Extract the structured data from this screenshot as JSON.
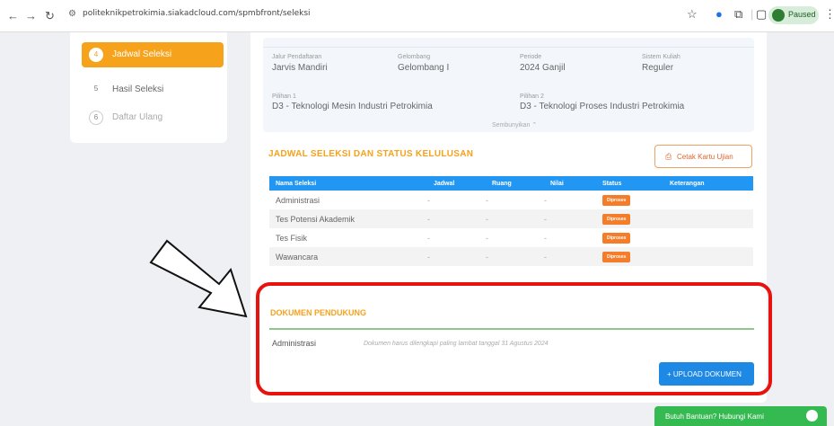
{
  "browser": {
    "url": "politeknikpetrokimia.siakadcloud.com/spmbfront/seleksi",
    "paused_label": "Paused",
    "colors": {
      "paused_bg": "#d7ecd9"
    }
  },
  "sidebar": {
    "items": [
      {
        "num": "4",
        "label": "Jadwal Seleksi",
        "active": true
      },
      {
        "num": "5",
        "label": "Hasil Seleksi",
        "active": false
      },
      {
        "num": "6",
        "label": "Daftar Ulang",
        "active": false
      }
    ]
  },
  "info": {
    "jalur_label": "Jalur Pendaftaran",
    "jalur_value": "Jarvis Mandiri",
    "gelombang_label": "Gelombang",
    "gelombang_value": "Gelombang I",
    "periode_label": "Periode",
    "periode_value": "2024 Ganjil",
    "sistem_label": "Sistem Kuliah",
    "sistem_value": "Reguler",
    "pilihan1_label": "Pilihan 1",
    "pilihan1_value": "D3 - Teknologi Mesin Industri Petrokimia",
    "pilihan2_label": "Pilihan 2",
    "pilihan2_value": "D3 - Teknologi Proses Industri Petrokimia",
    "hide_label": "Sembunyikan ⌃"
  },
  "jadwal": {
    "title": "JADWAL SELEKSI DAN STATUS KELULUSAN",
    "print_button": "Cetak Kartu Ujian",
    "columns": [
      "Nama Seleksi",
      "Jadwal",
      "Ruang",
      "Nilai",
      "Status",
      "Keterangan"
    ],
    "rows": [
      {
        "nama": "Administrasi",
        "jadwal": "-",
        "ruang": "-",
        "nilai": "-",
        "status": "Diproses",
        "keterangan": ""
      },
      {
        "nama": "Tes Potensi Akademik",
        "jadwal": "-",
        "ruang": "-",
        "nilai": "-",
        "status": "Diproses",
        "keterangan": ""
      },
      {
        "nama": "Tes Fisik",
        "jadwal": "-",
        "ruang": "-",
        "nilai": "-",
        "status": "Diproses",
        "keterangan": ""
      },
      {
        "nama": "Wawancara",
        "jadwal": "-",
        "ruang": "-",
        "nilai": "-",
        "status": "Diproses",
        "keterangan": ""
      }
    ]
  },
  "dokumen": {
    "title": "DOKUMEN PENDUKUNG",
    "row_label": "Administrasi",
    "row_note": "Dokumen harus dilengkapi paling lambat tanggal 31 Agustus 2024",
    "upload_button": "+ UPLOAD DOKUMEN"
  },
  "help": {
    "label": "Butuh Bantuan? Hubungi Kami"
  },
  "colors": {
    "accent": "#f7a21b",
    "table_header": "#2196f3",
    "badge": "#f57c28",
    "upload": "#1e88e5",
    "highlight": "#e8120e",
    "help": "#35ba51"
  }
}
